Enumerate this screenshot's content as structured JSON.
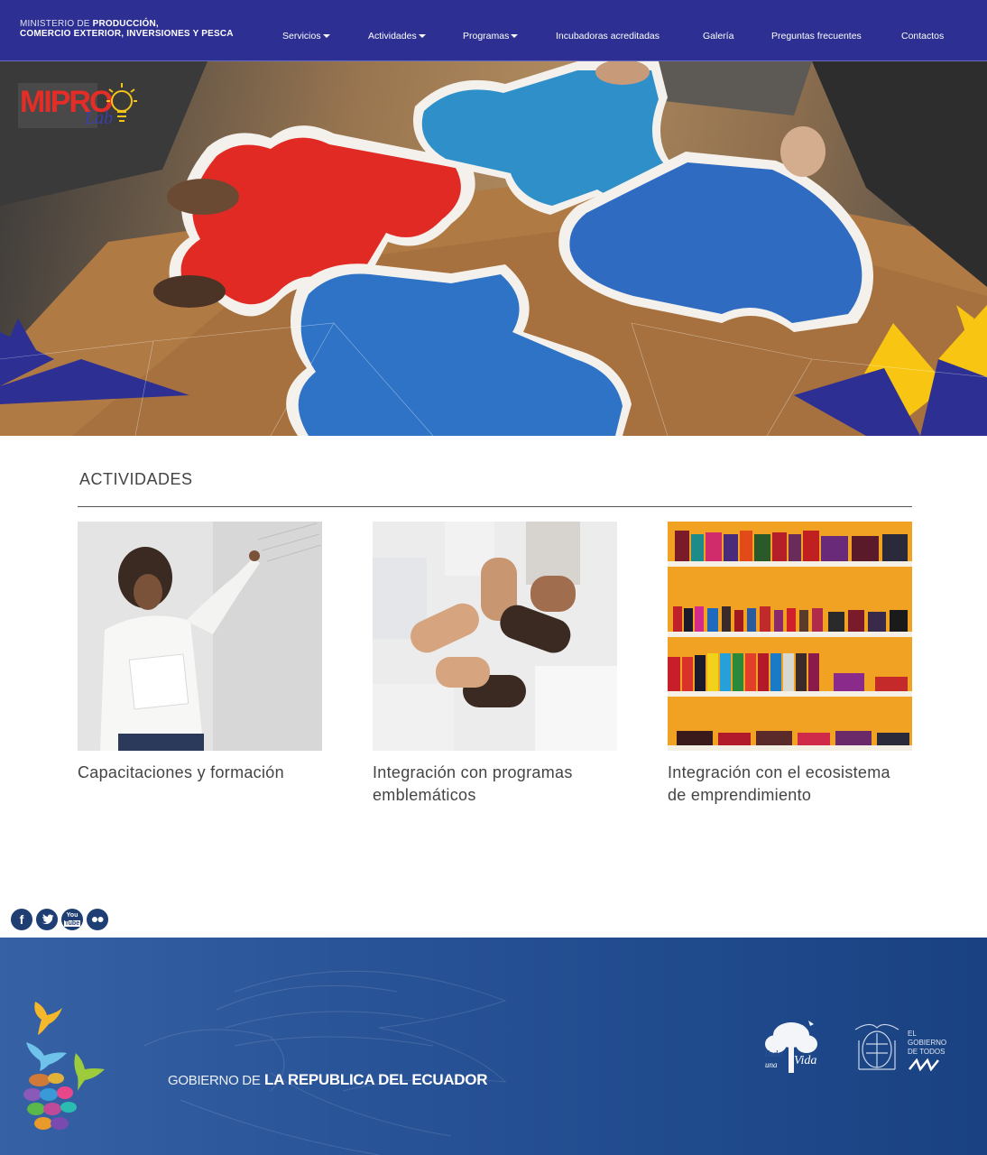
{
  "header": {
    "brand_line1_light": "Ministerio de",
    "brand_line1_bold": "Producción,",
    "brand_line2": "Comercio Exterior, Inversiones y Pesca",
    "colors": {
      "nav_bg": "#2d2f93",
      "text": "#ffffff"
    }
  },
  "nav": {
    "items": [
      {
        "label": "Servicios",
        "dropdown": true
      },
      {
        "label": "Actividades",
        "dropdown": true
      },
      {
        "label": "Programas",
        "dropdown": true
      },
      {
        "label": "Incubadoras acreditadas",
        "dropdown": false
      },
      {
        "label": "Galería",
        "dropdown": false
      },
      {
        "label": "Preguntas frecuentes",
        "dropdown": false
      },
      {
        "label": "Contactos",
        "dropdown": false
      }
    ]
  },
  "hero": {
    "logo_main": "MIPRO",
    "logo_sub": "Lab",
    "image_subject": "puzzle pieces held by hands"
  },
  "section": {
    "title": "ACTIVIDADES",
    "cards": [
      {
        "caption": "Capacitaciones y formación",
        "image": "woman-at-whiteboard"
      },
      {
        "caption": "Integración con programas emblemáticos",
        "image": "linked-hands"
      },
      {
        "caption": "Integración con el ecosistema de emprendimiento",
        "image": "shelves-of-colorful-wallets"
      }
    ]
  },
  "social": {
    "icons": [
      "facebook-icon",
      "twitter-icon",
      "youtube-icon",
      "flickr-icon"
    ],
    "color": "#1f3e73"
  },
  "footer": {
    "gov_light": "GOBIERNO DE",
    "gov_bold": "LA REPUBLICA DEL ECUADOR",
    "logo_toda_una_vida": "Toda una Vida",
    "logo_gobierno_todos": [
      "EL",
      "GOBIERNO",
      "DE TODOS"
    ],
    "colors": {
      "bg": "#2a5498"
    }
  }
}
